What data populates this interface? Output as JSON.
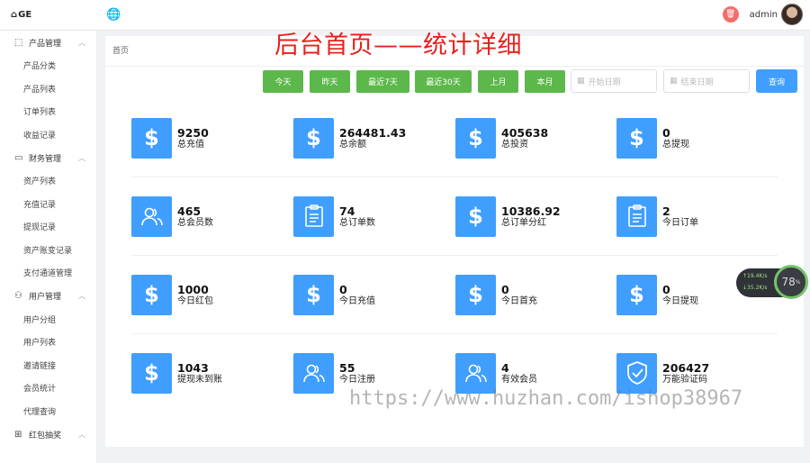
{
  "topbar": {
    "logo": "GE",
    "admin": "admin",
    "icons": [
      "home-icon",
      "globe-icon",
      "trash-icon",
      "avatar"
    ]
  },
  "sidebar": [
    {
      "label": "产品管理",
      "icon": "cube-icon",
      "items": [
        "产品分类",
        "产品列表",
        "订单列表",
        "收益记录"
      ]
    },
    {
      "label": "财务管理",
      "icon": "wallet-icon",
      "items": [
        "资产列表",
        "充值记录",
        "提现记录",
        "资产账变记录",
        "支付通道管理"
      ]
    },
    {
      "label": "用户管理",
      "icon": "user-icon",
      "items": [
        "用户分组",
        "用户列表",
        "邀请链接",
        "会员统计",
        "代理查询"
      ]
    },
    {
      "label": "红包抽奖",
      "icon": "gift-icon",
      "items": []
    }
  ],
  "breadcrumb": "首页",
  "overlay_title": "后台首页——统计详细",
  "filters": {
    "buttons": [
      "今天",
      "昨天",
      "最近7天",
      "最近30天",
      "上月",
      "本月"
    ],
    "start_placeholder": "开始日期",
    "end_placeholder": "结束日期",
    "query": "查询"
  },
  "stats": [
    {
      "value": "9250",
      "label": "总充值",
      "icon": "dollar-icon"
    },
    {
      "value": "264481.43",
      "label": "总余额",
      "icon": "dollar-icon"
    },
    {
      "value": "405638",
      "label": "总投资",
      "icon": "dollar-icon"
    },
    {
      "value": "0",
      "label": "总提现",
      "icon": "dollar-icon"
    },
    {
      "value": "465",
      "label": "总会员数",
      "icon": "users-icon"
    },
    {
      "value": "74",
      "label": "总订单数",
      "icon": "clipboard-icon"
    },
    {
      "value": "10386.92",
      "label": "总订单分红",
      "icon": "dollar-icon"
    },
    {
      "value": "2",
      "label": "今日订单",
      "icon": "clipboard-icon"
    },
    {
      "value": "1000",
      "label": "今日红包",
      "icon": "dollar-icon"
    },
    {
      "value": "0",
      "label": "今日充值",
      "icon": "dollar-icon"
    },
    {
      "value": "0",
      "label": "今日首充",
      "icon": "dollar-icon"
    },
    {
      "value": "0",
      "label": "今日提现",
      "icon": "dollar-icon"
    },
    {
      "value": "1043",
      "label": "提现未到账",
      "icon": "dollar-icon"
    },
    {
      "value": "55",
      "label": "今日注册",
      "icon": "users-icon"
    },
    {
      "value": "4",
      "label": "有效会员",
      "icon": "users-icon"
    },
    {
      "value": "206427",
      "label": "万能验证码",
      "icon": "shield-check-icon"
    }
  ],
  "watermark": "https://www.huzhan.com/ishop38967",
  "net_widget": {
    "up": "↑19.4K/s",
    "down": "↓35.2K/s",
    "percent": "78",
    "unit": "%"
  },
  "colors": {
    "accent": "#409eff",
    "filter_green": "#5cb84a",
    "title_red": "#e8211d"
  }
}
